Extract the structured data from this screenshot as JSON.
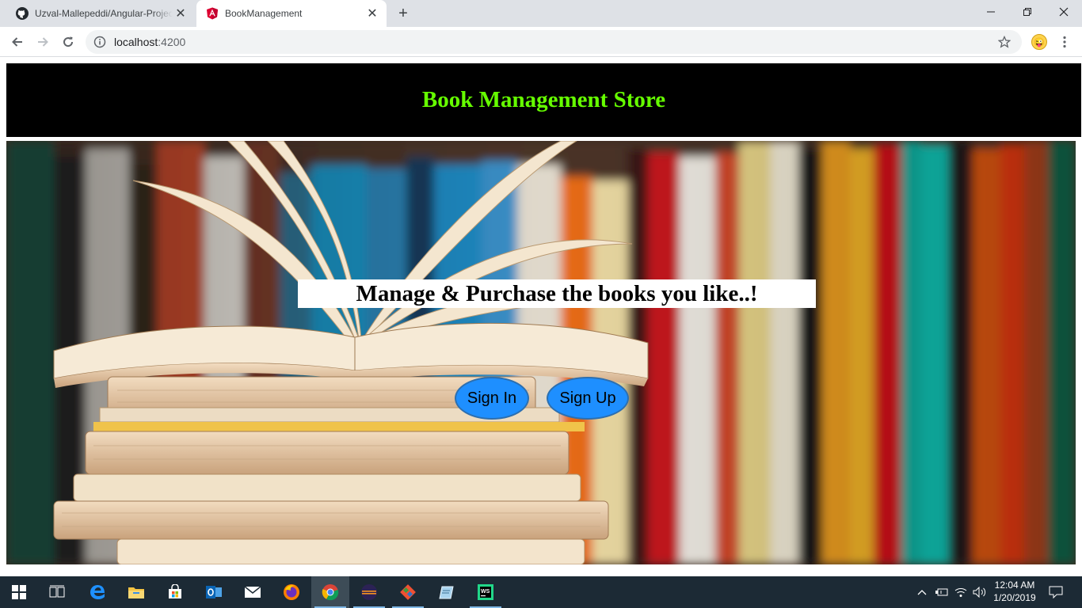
{
  "browser": {
    "tabs": [
      {
        "title": "Uzval-Mallepeddi/Angular-Projec",
        "favicon": "github-icon",
        "active": false
      },
      {
        "title": "BookManagement",
        "favicon": "angular-icon",
        "active": true
      }
    ],
    "address": {
      "host": "localhost",
      "port": ":4200"
    },
    "extension_icon": "emoji-extension-icon"
  },
  "page": {
    "header_title": "Book Management Store",
    "tagline": "Manage & Purchase the books you like..!",
    "buttons": {
      "sign_in": "Sign In",
      "sign_up": "Sign Up"
    },
    "hero_image": "bookshelf-with-open-books-image"
  },
  "taskbar": {
    "apps": [
      "start-icon",
      "task-view-icon",
      "edge-icon",
      "file-explorer-icon",
      "store-icon",
      "outlook-icon",
      "mail-icon",
      "firefox-icon",
      "chrome-icon",
      "eclipse-icon",
      "git-icon",
      "notepad-icon",
      "webstorm-icon"
    ],
    "clock": {
      "time": "12:04 AM",
      "date": "1/20/2019"
    }
  },
  "colors": {
    "header_bg": "#000000",
    "header_text": "#66ff00",
    "button_bg": "#1e8fff",
    "taskbar_bg": "#1c2a35"
  }
}
